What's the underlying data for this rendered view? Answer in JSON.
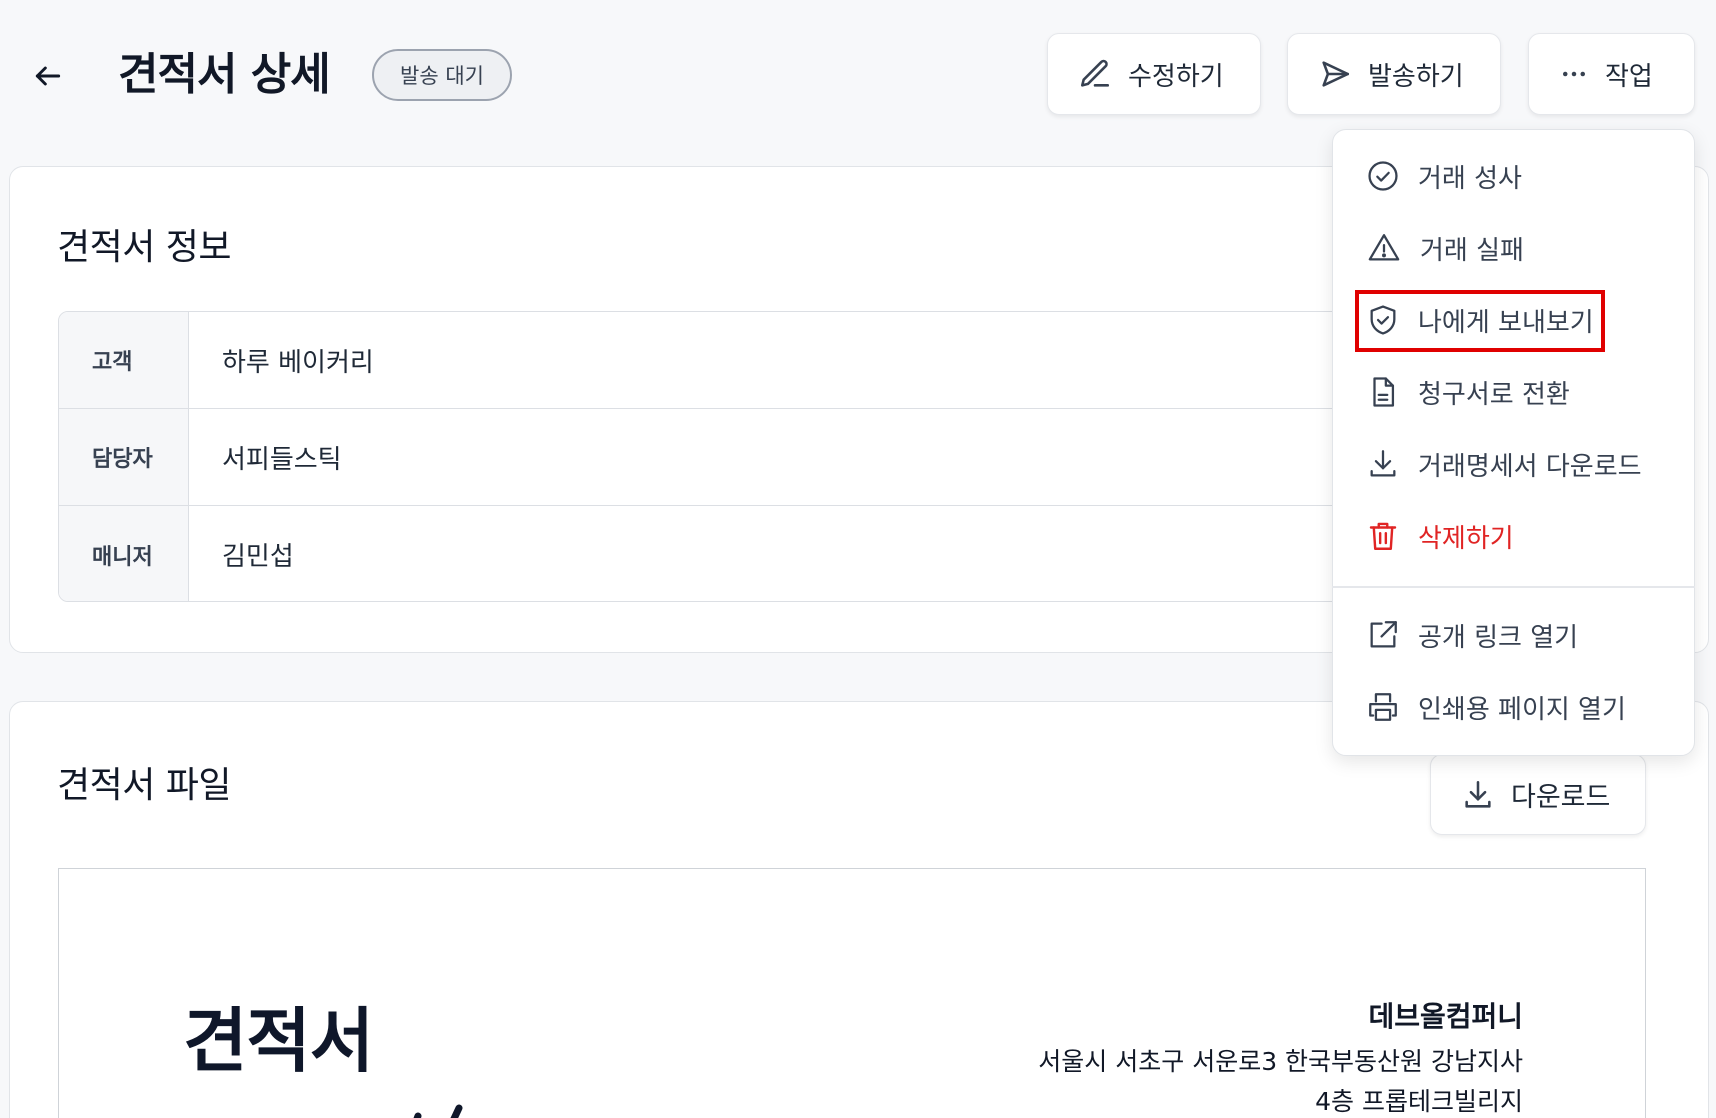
{
  "header": {
    "title": "견적서 상세",
    "status": "발송 대기",
    "edit_label": "수정하기",
    "send_label": "발송하기",
    "actions_label": "작업"
  },
  "info_card": {
    "title": "견적서 정보",
    "rows": [
      {
        "label": "고객",
        "value": "하루 베이커리"
      },
      {
        "label": "담당자",
        "value": "서피들스틱"
      },
      {
        "label": "매니저",
        "value": "김민섭"
      }
    ]
  },
  "file_card": {
    "title": "견적서 파일",
    "download_label": "다운로드",
    "document": {
      "title": "견적서",
      "company": "데브올컴퍼니",
      "address_line1": "서울시 서초구 서운로3 한국부동산원 강남지사",
      "address_line2": "4층 프롭테크빌리지"
    }
  },
  "actions_menu": {
    "items": [
      {
        "label": "거래 성사",
        "icon": "check-circle-icon"
      },
      {
        "label": "거래 실패",
        "icon": "warning-triangle-icon"
      },
      {
        "label": "나에게 보내보기",
        "icon": "shield-check-icon"
      },
      {
        "label": "청구서로 전환",
        "icon": "document-icon"
      },
      {
        "label": "거래명세서 다운로드",
        "icon": "download-icon"
      },
      {
        "label": "삭제하기",
        "icon": "trash-icon"
      },
      {
        "label": "공개 링크 열기",
        "icon": "external-link-icon"
      },
      {
        "label": "인쇄용 페이지 열기",
        "icon": "printer-icon"
      }
    ]
  },
  "colors": {
    "danger": "#e02424",
    "highlight": "#e00000"
  }
}
